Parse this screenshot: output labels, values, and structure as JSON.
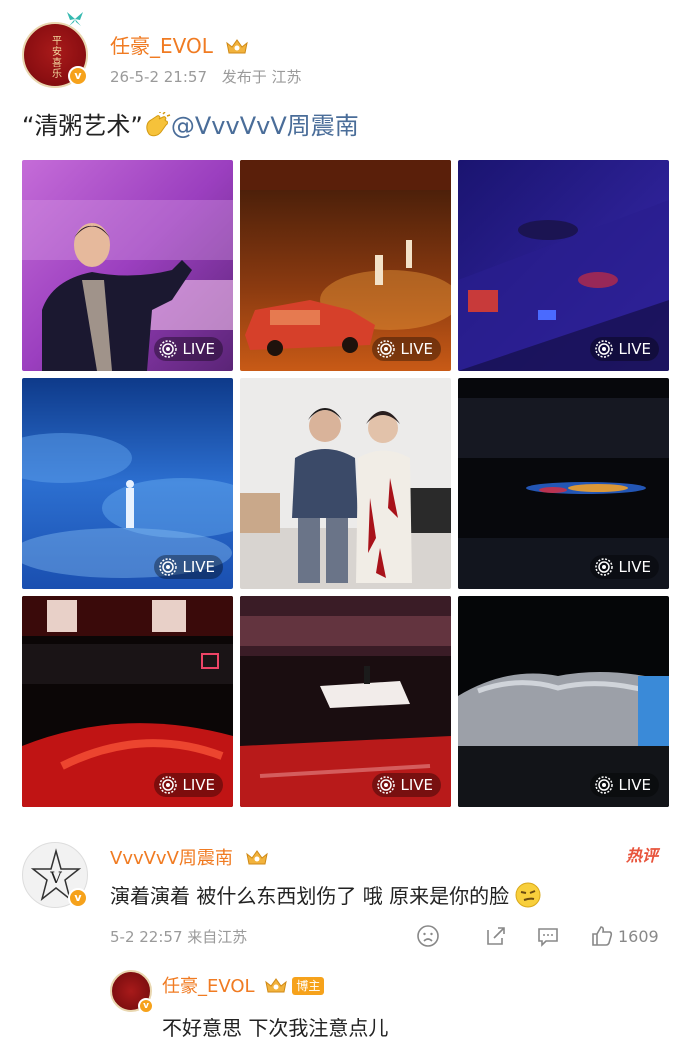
{
  "post": {
    "author": "任豪_EVOL",
    "time": "26-5-2 21:57",
    "location": "发布于 江苏",
    "text_quote": "“清粥艺术”",
    "mention": "@VvvVvV周震南",
    "avatar_seal": "平安喜乐"
  },
  "media": {
    "live_label": "LIVE",
    "tiles": [
      {
        "scene": "purple-concert-selfie",
        "live": true
      },
      {
        "scene": "orange-stage-car",
        "live": true
      },
      {
        "scene": "blue-stage-car",
        "live": true
      },
      {
        "scene": "blue-smoke-stage",
        "live": true
      },
      {
        "scene": "backstage-photo",
        "live": false
      },
      {
        "scene": "dark-arena-lights",
        "live": true
      },
      {
        "scene": "red-arena-screens",
        "live": true
      },
      {
        "scene": "red-arena-platform",
        "live": true
      },
      {
        "scene": "covered-stage",
        "live": true
      }
    ]
  },
  "comment": {
    "author": "VvvVvV周震南",
    "hot_label": "热评",
    "text": "演着演着 被什么东西划伤了 哦 原来是你的脸",
    "time": "5-2 22:57",
    "location": "来自江苏",
    "like_count": "1609",
    "reply": {
      "author": "任豪_EVOL",
      "author_tag": "博主",
      "text": "不好意思 下次我注意点儿"
    }
  },
  "colors": {
    "username": "#f07b22",
    "mention": "#4a6d99",
    "meta": "#9a9a9a",
    "hot": "#e8543c",
    "vip": "#f6a21b"
  }
}
